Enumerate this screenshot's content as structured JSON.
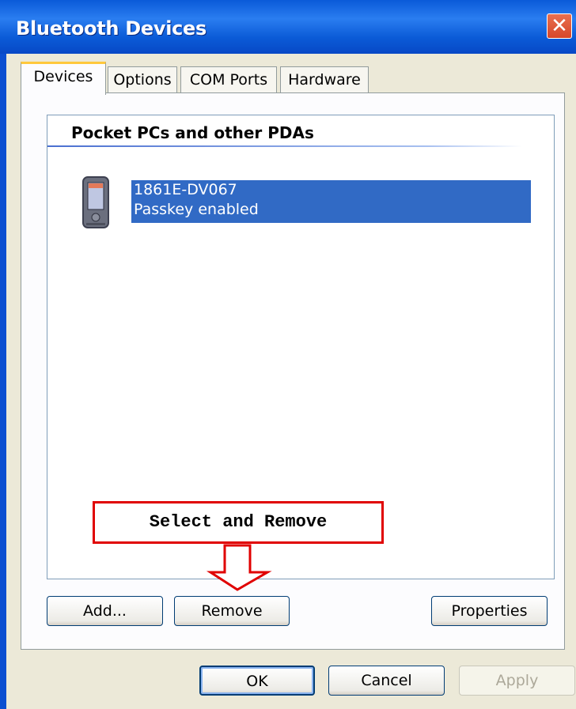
{
  "window": {
    "title": "Bluetooth Devices"
  },
  "tabs": [
    {
      "label": "Devices",
      "active": true
    },
    {
      "label": "Options",
      "active": false
    },
    {
      "label": "COM Ports",
      "active": false
    },
    {
      "label": "Hardware",
      "active": false
    }
  ],
  "list": {
    "group_header": "Pocket PCs and other PDAs",
    "devices": [
      {
        "name": "1861E-DV067",
        "status": "Passkey enabled",
        "icon": "pda-icon",
        "selected": true
      }
    ]
  },
  "panel_buttons": {
    "add": "Add...",
    "remove": "Remove",
    "properties": "Properties"
  },
  "dialog_buttons": {
    "ok": "OK",
    "cancel": "Cancel",
    "apply": "Apply"
  },
  "annotation": {
    "text": "Select and Remove",
    "color": "#e00000"
  },
  "colors": {
    "titlebar": "#0b5bd7",
    "selection": "#316ac5",
    "active_tab_accent": "#ffc83c"
  }
}
